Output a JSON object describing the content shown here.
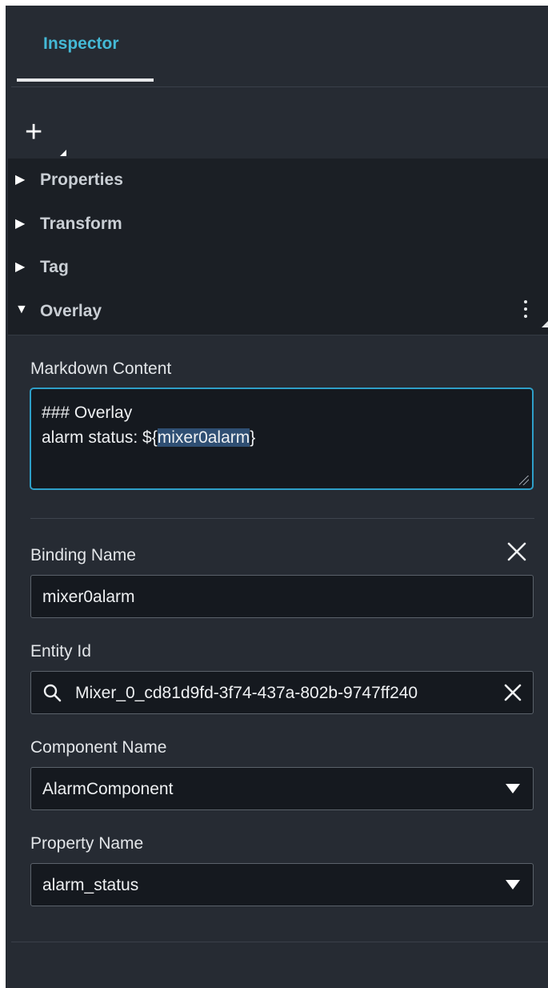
{
  "tabs": [
    {
      "label": "Inspector"
    }
  ],
  "add_button": {
    "label": "+"
  },
  "sections": {
    "properties": {
      "label": "Properties",
      "caret": "▶"
    },
    "transform": {
      "label": "Transform",
      "caret": "▶"
    },
    "tag": {
      "label": "Tag",
      "caret": "▶"
    },
    "overlay": {
      "label": "Overlay",
      "caret": "▼"
    }
  },
  "overlay": {
    "markdown_label": "Markdown Content",
    "markdown_line1": "### Overlay",
    "markdown_line2_prefix": "alarm status: ${",
    "markdown_line2_highlight": "mixer0alarm",
    "markdown_line2_suffix": "}",
    "binding_name_label": "Binding Name",
    "binding_name_value": "mixer0alarm",
    "entity_id_label": "Entity Id",
    "entity_id_value": "Mixer_0_cd81d9fd-3f74-437a-802b-9747ff240",
    "component_name_label": "Component Name",
    "component_name_value": "AlarmComponent",
    "property_name_label": "Property Name",
    "property_name_value": "alarm_status"
  },
  "colors": {
    "accent": "#44b9d6",
    "panel_bg": "#262b33",
    "section_bg": "#1b1f25",
    "input_bg": "#15191f",
    "focus_border": "#2e9fc8"
  },
  "icons": [
    "plus-icon",
    "caret-right-icon",
    "caret-down-icon",
    "kebab-menu-icon",
    "close-icon",
    "search-icon",
    "dropdown-arrow-icon"
  ]
}
